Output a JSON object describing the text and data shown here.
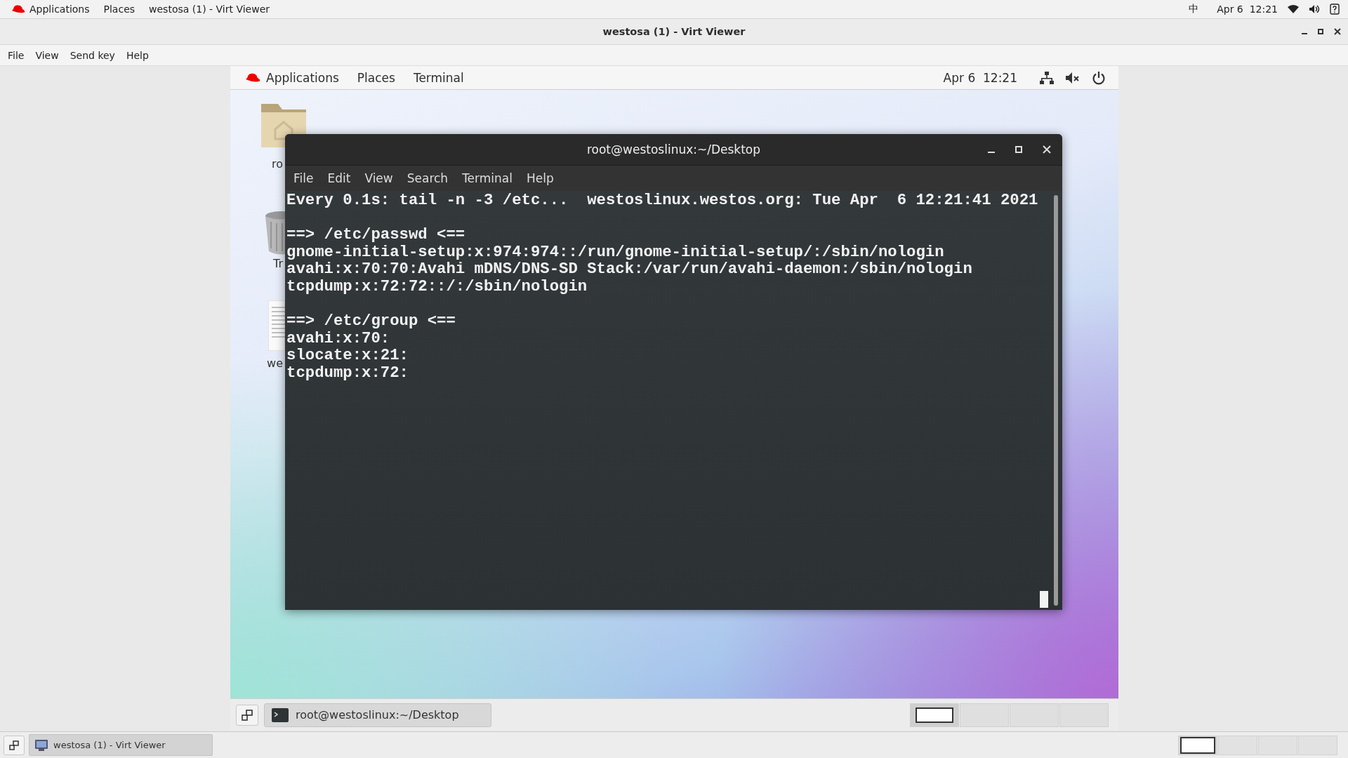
{
  "host_top_bar": {
    "menus": [
      {
        "label": "Applications",
        "kind": "logo"
      },
      {
        "label": "Places",
        "kind": "plain"
      },
      {
        "label": "westosa (1) - Virt Viewer",
        "kind": "plain"
      }
    ],
    "input_method": "中",
    "clock": "Apr 6  12:21"
  },
  "viewer_window": {
    "title": "westosa (1) - Virt Viewer",
    "menu": [
      "File",
      "View",
      "Send key",
      "Help"
    ]
  },
  "guest": {
    "top_bar": {
      "menus": [
        {
          "label": "Applications",
          "kind": "logo"
        },
        {
          "label": "Places",
          "kind": "plain"
        },
        {
          "label": "Terminal",
          "kind": "plain"
        }
      ],
      "clock": "Apr 6  12:21"
    },
    "desktop_icons": [
      {
        "kind": "home",
        "label": "ro"
      },
      {
        "kind": "trash",
        "label": "Tr"
      },
      {
        "kind": "document",
        "label": "we"
      }
    ],
    "terminal": {
      "title": "root@westoslinux:~/Desktop",
      "menu": [
        "File",
        "Edit",
        "View",
        "Search",
        "Terminal",
        "Help"
      ],
      "blocks": [
        {
          "lines": [
            "Every 0.1s: tail -n -3 /etc...  westoslinux.westos.org: Tue Apr  6 12:21:41 2021"
          ]
        },
        {
          "lines": [
            "==> /etc/passwd <==",
            "gnome-initial-setup:x:974:974::/run/gnome-initial-setup/:/sbin/nologin",
            "avahi:x:70:70:Avahi mDNS/DNS-SD Stack:/var/run/avahi-daemon:/sbin/nologin",
            "tcpdump:x:72:72::/:/sbin/nologin"
          ]
        },
        {
          "lines": [
            "==> /etc/group <==",
            "avahi:x:70:",
            "slocate:x:21:",
            "tcpdump:x:72:"
          ]
        }
      ]
    },
    "taskbar": {
      "tasks": [
        {
          "label": "root@westoslinux:~/Desktop"
        }
      ],
      "workspaces": [
        {
          "selected": true
        },
        {
          "selected": false
        },
        {
          "selected": false
        },
        {
          "selected": false
        }
      ]
    }
  },
  "host_taskbar": {
    "tasks": [
      {
        "label": "westosa (1) - Virt Viewer"
      }
    ],
    "workspaces": [
      {
        "selected": true
      },
      {
        "selected": false
      },
      {
        "selected": false
      },
      {
        "selected": false
      }
    ]
  }
}
